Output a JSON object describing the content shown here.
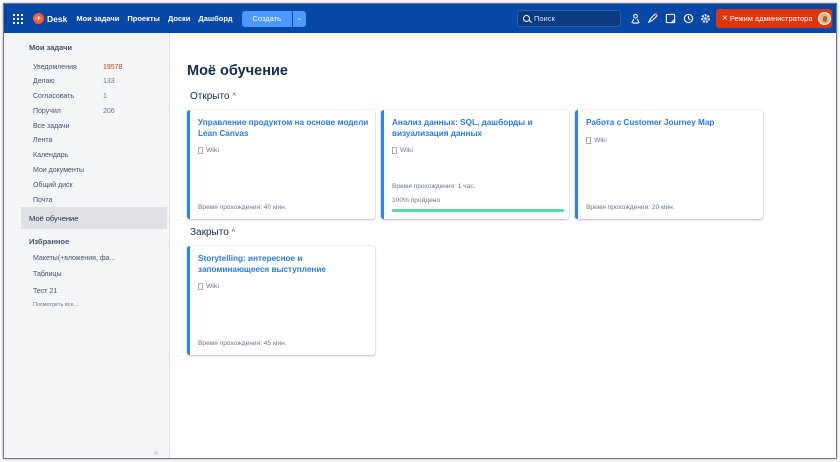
{
  "topbar": {
    "logo": "Desk",
    "nav": [
      "Мои задачи",
      "Проекты",
      "Доски",
      "Дашборд"
    ],
    "create_label": "Создать",
    "search_placeholder": "Поиск",
    "admin_label": "Режим администратора",
    "icons": [
      "users-icon",
      "rocket-icon",
      "notes-icon",
      "history-icon",
      "settings-icon"
    ]
  },
  "sidebar": {
    "my_tasks_heading": "Мои задачи",
    "items": [
      {
        "label": "Уведомления",
        "count": "19578"
      },
      {
        "label": "Делаю",
        "count": "133"
      },
      {
        "label": "Согласовать",
        "count": "1"
      },
      {
        "label": "Поручил",
        "count": "206"
      },
      {
        "label": "Все задачи",
        "count": ""
      },
      {
        "label": "Лента",
        "count": ""
      },
      {
        "label": "Календарь",
        "count": ""
      },
      {
        "label": "Мои документы",
        "count": ""
      },
      {
        "label": "Общий диск",
        "count": ""
      },
      {
        "label": "Почта",
        "count": ""
      }
    ],
    "active_item": "Моё обучение",
    "favorites_heading": "Избранное",
    "favorites": [
      "Макеты(+вложения, фа...",
      "Таблицы",
      "Тест 21"
    ],
    "show_all": "Посмотреть все...",
    "collapse_glyph": "«"
  },
  "main": {
    "title": "Моё обучение",
    "open_heading": "Открыто",
    "closed_heading": "Закрыто",
    "open_cards": [
      {
        "title": "Управление продуктом на основе модели Lean Canvas",
        "tag": "Wiki",
        "time": "Время прохождения: 40 мин."
      },
      {
        "title": "Анализ данных: SQL, дашборды и визуализация данных",
        "tag": "Wiki",
        "time": "Время прохождения: 1 час.",
        "status": "100% пройдено",
        "progress": 1.0
      },
      {
        "title": "Работа с Customer Journey Map",
        "tag": "Wiki",
        "time": "Время прохождения: 20 мин."
      }
    ],
    "closed_cards": [
      {
        "title": "Storytelling: интересное и запоминающееся выступление",
        "tag": "Wiki",
        "time": "Время прохождения: 45 мин."
      }
    ]
  },
  "colors": {
    "topbar": "#0747a6",
    "admin": "#de350b",
    "accent": "#2684ff",
    "link": "#2a7ae2",
    "progress": "#57d9a3"
  }
}
